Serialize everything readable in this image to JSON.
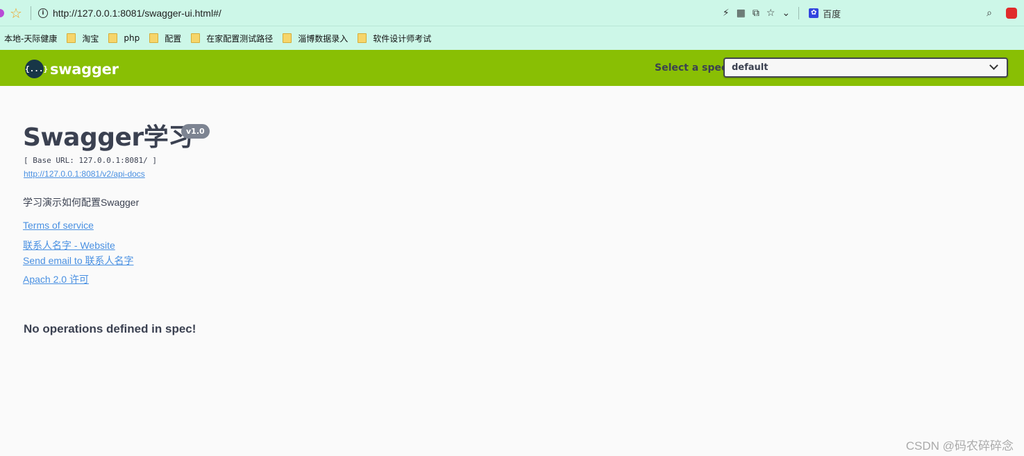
{
  "browser": {
    "url": "http://127.0.0.1:8081/swagger-ui.html#/",
    "search_engine": "百度"
  },
  "bookmarks": [
    {
      "label": "本地-天际健康",
      "icon": ""
    },
    {
      "label": "淘宝",
      "icon": "folder-icon"
    },
    {
      "label": "php",
      "icon": "folder-icon"
    },
    {
      "label": "配置",
      "icon": "folder-icon"
    },
    {
      "label": "在家配置测试路径",
      "icon": "folder-icon"
    },
    {
      "label": "淄博数据录入",
      "icon": "folder-icon"
    },
    {
      "label": "软件设计师考试",
      "icon": "folder-icon"
    }
  ],
  "topbar": {
    "logo_text": "swagger",
    "logo_glyph": "{...}",
    "spec_label": "Select a spec",
    "spec_value": "default",
    "bg_color": "#89bf04"
  },
  "info": {
    "title": "Swagger学习",
    "version": "v1.0",
    "base_url": "[ Base URL: 127.0.0.1:8081/ ]",
    "api_docs_url": "http://127.0.0.1:8081/v2/api-docs",
    "description": "学习演示如何配置Swagger",
    "terms": "Terms of service",
    "contact_website": "联系人名字 - Website",
    "contact_email": "Send email to 联系人名字",
    "license": "Apach 2.0 许可"
  },
  "main": {
    "no_operations": "No operations defined in spec!"
  },
  "watermark": "CSDN @码农碎碎念"
}
